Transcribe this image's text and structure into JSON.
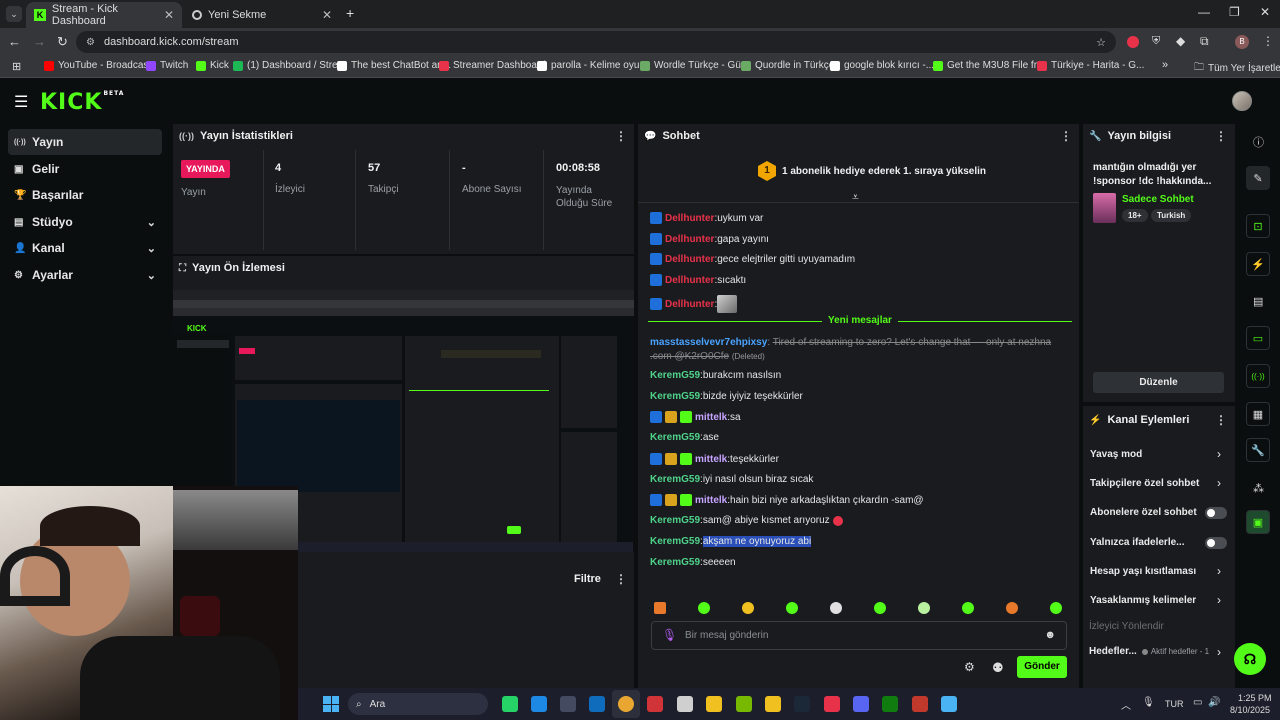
{
  "browser": {
    "tabs": [
      {
        "label": "Stream - Kick Dashboard",
        "active": true
      },
      {
        "label": "Yeni Sekme",
        "active": false
      }
    ],
    "url": "dashboard.kick.com/stream",
    "profile_initial": "B",
    "bookmarks": [
      {
        "label": "YouTube - Broadcas...",
        "color": "#ff0000"
      },
      {
        "label": "Twitch",
        "color": "#9146ff"
      },
      {
        "label": "Kick",
        "color": "#53fc18"
      },
      {
        "label": "(1) Dashboard / Stre...",
        "color": "#1db954"
      },
      {
        "label": "The best ChatBot an...",
        "color": "#ffffff"
      },
      {
        "label": "Streamer Dashboard",
        "color": "#e8324a"
      },
      {
        "label": "parolla - Kelime oyu...",
        "color": "#ffffff"
      },
      {
        "label": "Wordle Türkçe - Gü...",
        "color": "#6aaa64"
      },
      {
        "label": "Quordle in Türkçe",
        "color": "#6aaa64"
      },
      {
        "label": "google blok kırıcı -...",
        "color": "#ffffff"
      },
      {
        "label": "Get the M3U8 File fr...",
        "color": "#53fc18"
      },
      {
        "label": "Türkiye - Harita - G...",
        "color": "#e8324a"
      }
    ],
    "all_bookmarks": "Tüm Yer İşaretleri"
  },
  "kick": {
    "logo": "KICK",
    "logo_sup": "BETA"
  },
  "nav": [
    {
      "label": "Yayın",
      "icon": "broadcast-icon",
      "glyph": "((·))",
      "active": true,
      "chevron": false
    },
    {
      "label": "Gelir",
      "icon": "revenue-icon",
      "glyph": "▣",
      "active": false,
      "chevron": false
    },
    {
      "label": "Başarılar",
      "icon": "trophy-icon",
      "glyph": "🏆",
      "active": false,
      "chevron": false
    },
    {
      "label": "Stüdyo",
      "icon": "studio-icon",
      "glyph": "▤",
      "active": false,
      "chevron": true
    },
    {
      "label": "Kanal",
      "icon": "channel-icon",
      "glyph": "👤",
      "active": false,
      "chevron": true
    },
    {
      "label": "Ayarlar",
      "icon": "settings-icon",
      "glyph": "⚙",
      "active": false,
      "chevron": true
    }
  ],
  "stats": {
    "title": "Yayın İstatistikleri",
    "live_badge": "YAYINDA",
    "live_label": "Yayın",
    "items": [
      {
        "value": "4",
        "label": "İzleyici"
      },
      {
        "value": "57",
        "label": "Takipçi"
      },
      {
        "value": "-",
        "label": "Abone Sayısı"
      },
      {
        "value": "00:08:58",
        "label": "Yayında Olduğu Süre"
      }
    ]
  },
  "preview": {
    "title": "Yayın Ön İzlemesi",
    "filter_label": "Filtre"
  },
  "chat": {
    "title": "Sohbet",
    "sub_goal_number": "1",
    "sub_goal_text": "1 abonelik hediye ederek 1. sıraya yükselin",
    "new_messages": "Yeni mesajlar",
    "messages": [
      {
        "user": "Dellhunter",
        "text": "uykum var",
        "ucolor": "red",
        "badges": [
          "blue"
        ]
      },
      {
        "user": "Dellhunter",
        "text": "gapa yayını",
        "ucolor": "red",
        "badges": [
          "blue"
        ]
      },
      {
        "user": "Dellhunter",
        "text": "gece elejtriler gitti uyuyamadım",
        "ucolor": "red",
        "badges": [
          "blue"
        ]
      },
      {
        "user": "Dellhunter",
        "text": "sıcaktı",
        "ucolor": "red",
        "badges": [
          "blue"
        ]
      },
      {
        "user": "Dellhunter",
        "text": "",
        "ucolor": "red",
        "badges": [
          "blue"
        ]
      }
    ],
    "deleted": {
      "user": "masstasselvevr7ehpixsy",
      "text": "Tired of streaming to zero? Let's change that — only at nezhna .com @K2rO0Cfe",
      "tag": "(Deleted)"
    },
    "messages2": [
      {
        "user": "KeremG59",
        "text": "burakcım nasılsın",
        "ucolor": "green",
        "badges": []
      },
      {
        "user": "KeremG59",
        "text": "bizde iyiyiz teşekkürler",
        "ucolor": "green",
        "badges": []
      },
      {
        "user": "mittelk",
        "text": "sa",
        "ucolor": "purple",
        "badges": [
          "blue",
          "gold",
          "green"
        ]
      },
      {
        "user": "KeremG59",
        "text": "ase",
        "ucolor": "green",
        "badges": []
      },
      {
        "user": "mittelk",
        "text": "teşekkürler",
        "ucolor": "purple",
        "badges": [
          "blue",
          "gold",
          "green"
        ]
      },
      {
        "user": "KeremG59",
        "text": "iyi nasıl olsun biraz sıcak",
        "ucolor": "green",
        "badges": []
      },
      {
        "user": "mittelk",
        "text": "hain bizi niye arkadaşlıktan çıkardın -sam@",
        "ucolor": "purple",
        "badges": [
          "blue",
          "gold",
          "green"
        ]
      },
      {
        "user": "KeremG59",
        "text": "sam@ abiye kısmet arıyoruz",
        "ucolor": "green",
        "badges": []
      },
      {
        "user": "KeremG59",
        "text": "akşam ne oynuyoruz abi",
        "ucolor": "green",
        "badges": [],
        "highlight": true
      },
      {
        "user": "KeremG59",
        "text": "seeeen",
        "ucolor": "green",
        "badges": []
      }
    ],
    "input_placeholder": "Bir mesaj gönderin",
    "send_label": "Gönder"
  },
  "stream_info": {
    "title": "Yayın bilgisi",
    "stream_title": "mantığın olmadığı yer !sponsor !dc !hakkında...",
    "category": "Sadece Sohbet",
    "tags": [
      "18+",
      "Turkish"
    ],
    "edit_label": "Düzenle"
  },
  "channel_actions": {
    "title": "Kanal Eylemleri",
    "items": [
      {
        "label": "Yavaş mod",
        "control": "chevron"
      },
      {
        "label": "Takipçilere özel sohbet",
        "control": "chevron"
      },
      {
        "label": "Abonelere özel sohbet",
        "control": "toggle"
      },
      {
        "label": "Yalnızca ifadelerle...",
        "control": "toggle"
      },
      {
        "label": "Hesap yaşı kısıtlaması",
        "control": "chevron"
      },
      {
        "label": "Yasaklanmış kelimeler",
        "control": "chevron"
      }
    ],
    "viewer_redirect": "İzleyici Yönlendir",
    "goals_label": "Hedefler...",
    "goals_status": "Aktif hedefler - 1"
  },
  "taskbar": {
    "search_label": "Ara",
    "lang": "TUR",
    "time": "1:25 PM",
    "date": "8/10/2025"
  }
}
